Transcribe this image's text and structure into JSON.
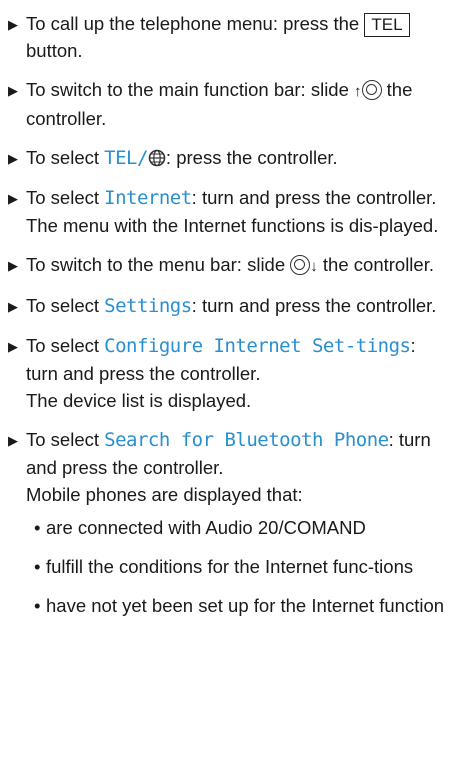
{
  "steps": [
    {
      "pre": "To call up the telephone menu: press the ",
      "button": "TEL",
      "post": " button."
    },
    {
      "pre": "To switch to the main function bar: slide ",
      "post": " the controller."
    },
    {
      "pre": "To select ",
      "code": "TEL/",
      "post": ": press the controller."
    },
    {
      "pre": "To select ",
      "code": "Internet",
      "post": ": turn and press the controller.",
      "result": "The menu with the Internet functions is dis-played."
    },
    {
      "pre": "To switch to the menu bar: slide ",
      "post": " the controller."
    },
    {
      "pre": "To select ",
      "code": "Settings",
      "post": ": turn and press the controller."
    },
    {
      "pre": "To select ",
      "code": "Configure Internet Set-tings",
      "post": ": turn and press the controller.",
      "result": "The device list is displayed."
    },
    {
      "pre": "To select ",
      "code": "Search for Bluetooth Phone",
      "post": ": turn and press the controller.",
      "result": "Mobile phones are displayed that:"
    }
  ],
  "bullets": [
    "are connected with Audio 20/COMAND",
    "fulfill the conditions for the Internet func-tions",
    "have not yet been set up for the Internet function"
  ],
  "icons": {
    "step_marker": "triangle-right-icon",
    "controller": "controller-knob-icon",
    "globe": "globe-icon"
  }
}
